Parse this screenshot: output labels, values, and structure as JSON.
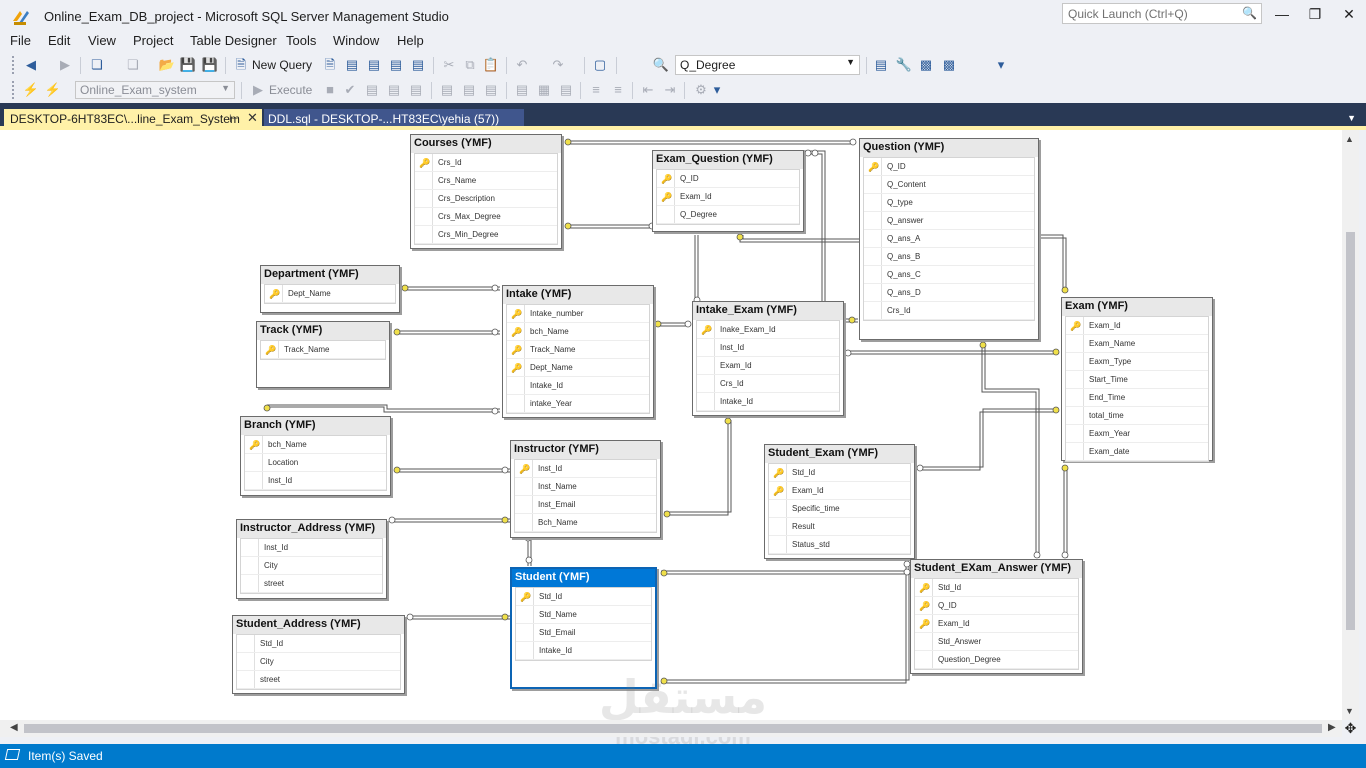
{
  "window": {
    "title": "Online_Exam_DB_project - Microsoft SQL Server Management Studio",
    "quick_launch_placeholder": "Quick Launch (Ctrl+Q)"
  },
  "menu": [
    "File",
    "Edit",
    "View",
    "Project",
    "Table Designer",
    "Tools",
    "Window",
    "Help"
  ],
  "toolbar": {
    "new_query": "New Query",
    "search_combo": "Q_Degree",
    "database_combo": "Online_Exam_system",
    "execute": "Execute"
  },
  "tabs": {
    "active": "DESKTOP-6HT83EC\\...line_Exam_System",
    "inactive": "DDL.sql - DESKTOP-...HT83EC\\yehia (57))"
  },
  "tables": {
    "courses": {
      "title": "Courses (YMF)",
      "columns": [
        {
          "name": "Crs_Id",
          "key": true
        },
        {
          "name": "Crs_Name",
          "key": false
        },
        {
          "name": "Crs_Description",
          "key": false
        },
        {
          "name": "Crs_Max_Degree",
          "key": false
        },
        {
          "name": "Crs_Min_Degree",
          "key": false
        }
      ]
    },
    "exam_question": {
      "title": "Exam_Question (YMF)",
      "columns": [
        {
          "name": "Q_ID",
          "key": true
        },
        {
          "name": "Exam_Id",
          "key": true
        },
        {
          "name": "Q_Degree",
          "key": false
        }
      ]
    },
    "question": {
      "title": "Question (YMF)",
      "columns": [
        {
          "name": "Q_ID",
          "key": true
        },
        {
          "name": "Q_Content",
          "key": false
        },
        {
          "name": "Q_type",
          "key": false
        },
        {
          "name": "Q_answer",
          "key": false
        },
        {
          "name": "Q_ans_A",
          "key": false
        },
        {
          "name": "Q_ans_B",
          "key": false
        },
        {
          "name": "Q_ans_C",
          "key": false
        },
        {
          "name": "Q_ans_D",
          "key": false
        },
        {
          "name": "Crs_Id",
          "key": false
        }
      ]
    },
    "department": {
      "title": "Department (YMF)",
      "columns": [
        {
          "name": "Dept_Name",
          "key": true
        }
      ]
    },
    "intake": {
      "title": "Intake (YMF)",
      "columns": [
        {
          "name": "Intake_number",
          "key": true
        },
        {
          "name": "bch_Name",
          "key": true
        },
        {
          "name": "Track_Name",
          "key": true
        },
        {
          "name": "Dept_Name",
          "key": true
        },
        {
          "name": "Intake_Id",
          "key": false
        },
        {
          "name": "intake_Year",
          "key": false
        }
      ]
    },
    "intake_exam": {
      "title": "Intake_Exam (YMF)",
      "columns": [
        {
          "name": "Inake_Exam_Id",
          "key": true
        },
        {
          "name": "Inst_Id",
          "key": false
        },
        {
          "name": "Exam_Id",
          "key": false
        },
        {
          "name": "Crs_Id",
          "key": false
        },
        {
          "name": "Intake_Id",
          "key": false
        }
      ]
    },
    "exam": {
      "title": "Exam (YMF)",
      "columns": [
        {
          "name": "Exam_Id",
          "key": true
        },
        {
          "name": "Exam_Name",
          "key": false
        },
        {
          "name": "Eaxm_Type",
          "key": false
        },
        {
          "name": "Start_Time",
          "key": false
        },
        {
          "name": "End_Time",
          "key": false
        },
        {
          "name": "total_time",
          "key": false
        },
        {
          "name": "Eaxm_Year",
          "key": false
        },
        {
          "name": "Exam_date",
          "key": false
        }
      ]
    },
    "track": {
      "title": "Track (YMF)",
      "columns": [
        {
          "name": "Track_Name",
          "key": true
        }
      ]
    },
    "branch": {
      "title": "Branch (YMF)",
      "columns": [
        {
          "name": "bch_Name",
          "key": true
        },
        {
          "name": "Location",
          "key": false
        },
        {
          "name": "Inst_Id",
          "key": false
        }
      ]
    },
    "instructor": {
      "title": "Instructor (YMF)",
      "columns": [
        {
          "name": "Inst_Id",
          "key": true
        },
        {
          "name": "Inst_Name",
          "key": false
        },
        {
          "name": "Inst_Email",
          "key": false
        },
        {
          "name": "Bch_Name",
          "key": false
        }
      ]
    },
    "student_exam": {
      "title": "Student_Exam (YMF)",
      "columns": [
        {
          "name": "Std_Id",
          "key": true
        },
        {
          "name": "Exam_Id",
          "key": true
        },
        {
          "name": "Specific_time",
          "key": false
        },
        {
          "name": "Result",
          "key": false
        },
        {
          "name": "Status_std",
          "key": false
        }
      ]
    },
    "instructor_address": {
      "title": "Instructor_Address (YMF)",
      "columns": [
        {
          "name": "Inst_Id",
          "key": false
        },
        {
          "name": "City",
          "key": false
        },
        {
          "name": "street",
          "key": false
        }
      ]
    },
    "student": {
      "title": "Student (YMF)",
      "columns": [
        {
          "name": "Std_Id",
          "key": true
        },
        {
          "name": "Std_Name",
          "key": false
        },
        {
          "name": "Std_Email",
          "key": false
        },
        {
          "name": "Intake_Id",
          "key": false
        }
      ]
    },
    "student_exam_answer": {
      "title": "Student_EXam_Answer (YMF)",
      "columns": [
        {
          "name": "Std_Id",
          "key": true
        },
        {
          "name": "Q_ID",
          "key": true
        },
        {
          "name": "Exam_Id",
          "key": true
        },
        {
          "name": "Std_Answer",
          "key": false
        },
        {
          "name": "Question_Degree",
          "key": false
        }
      ]
    },
    "student_address": {
      "title": "Student_Address (YMF)",
      "columns": [
        {
          "name": "Std_Id",
          "key": false
        },
        {
          "name": "City",
          "key": false
        },
        {
          "name": "street",
          "key": false
        }
      ]
    }
  },
  "status": {
    "text": "Item(s) Saved",
    "color": "#007acc"
  },
  "watermark": {
    "arabic": "مستقل",
    "latin": "mostaql.com"
  }
}
